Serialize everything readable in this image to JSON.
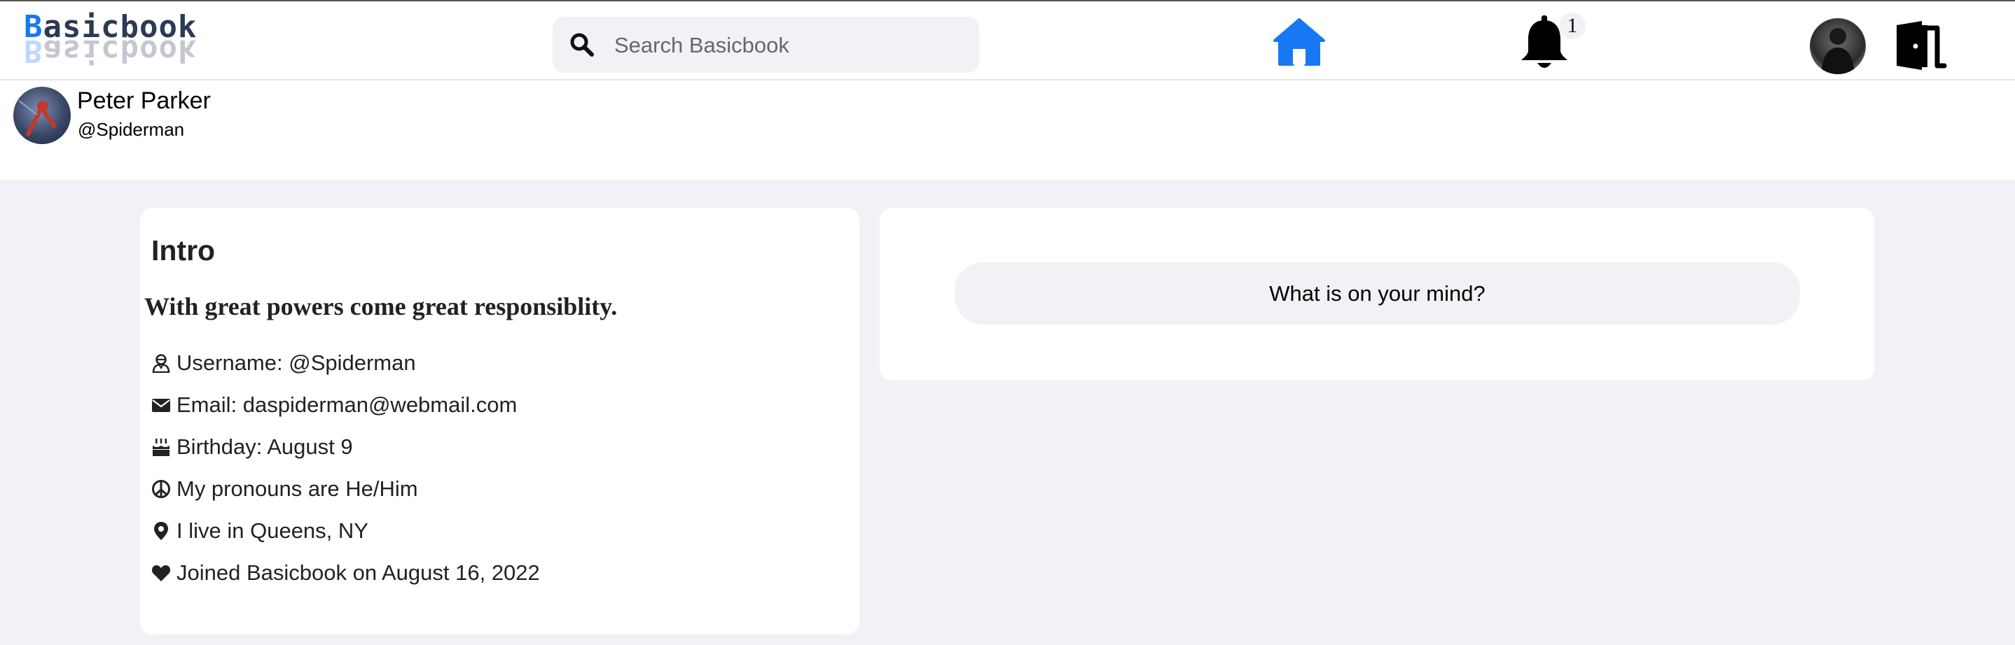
{
  "app": {
    "logo_first": "B",
    "logo_rest": "asicbook"
  },
  "search": {
    "placeholder": "Search Basicbook"
  },
  "notifications": {
    "count": "1"
  },
  "profile": {
    "name": "Peter Parker",
    "handle": "@Spiderman"
  },
  "intro": {
    "title": "Intro",
    "bio": "With great powers come great responsiblity.",
    "rows": [
      {
        "icon": "user-icon",
        "text": "Username: @Spiderman"
      },
      {
        "icon": "envelope-icon",
        "text": "Email: daspiderman@webmail.com"
      },
      {
        "icon": "cake-icon",
        "text": "Birthday: August 9"
      },
      {
        "icon": "peace-icon",
        "text": "My pronouns are He/Him"
      },
      {
        "icon": "map-pin-icon",
        "text": "I live in Queens, NY"
      },
      {
        "icon": "heart-icon",
        "text": "Joined Basicbook on August 16, 2022"
      }
    ]
  },
  "composer": {
    "prompt": "What is on your mind?"
  },
  "colors": {
    "accent": "#1877f2",
    "page_bg": "#f0f2f5"
  }
}
